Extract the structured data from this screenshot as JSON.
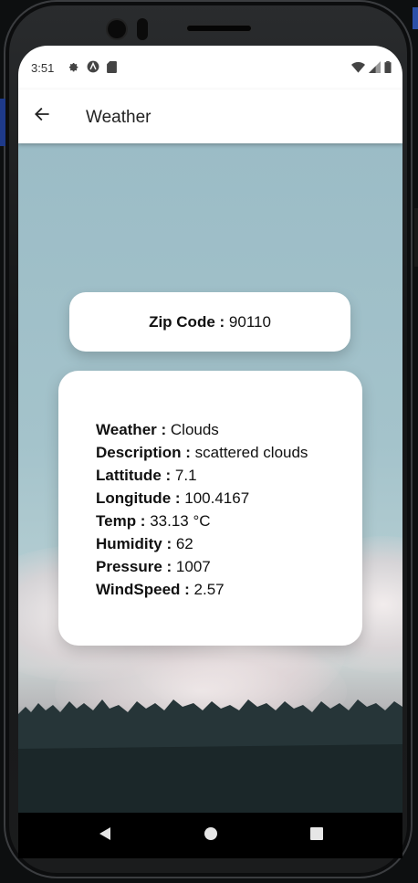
{
  "status_bar": {
    "time": "3:51",
    "icons_left": [
      "gear-icon",
      "a-circle-icon",
      "sd-card-icon"
    ],
    "icons_right": [
      "wifi-icon",
      "signal-icon",
      "battery-icon"
    ]
  },
  "app_bar": {
    "title": "Weather",
    "back_icon": "arrow-left-icon"
  },
  "zip": {
    "label": "Zip Code :",
    "value": "90110"
  },
  "weather": [
    {
      "label": "Weather :",
      "value": "Clouds"
    },
    {
      "label": "Description :",
      "value": "scattered clouds"
    },
    {
      "label": "Lattitude :",
      "value": "7.1"
    },
    {
      "label": "Longitude :",
      "value": "100.4167"
    },
    {
      "label": "Temp :",
      "value": "33.13 °C"
    },
    {
      "label": "Humidity :",
      "value": "62"
    },
    {
      "label": "Pressure :",
      "value": "1007"
    },
    {
      "label": "WindSpeed :",
      "value": "2.57"
    }
  ],
  "nav_bar": {
    "icons": [
      "back-triangle-icon",
      "home-circle-icon",
      "recents-square-icon"
    ]
  },
  "colors": {
    "sky": "#9bbcc6",
    "card": "#ffffff",
    "text": "#111111"
  }
}
